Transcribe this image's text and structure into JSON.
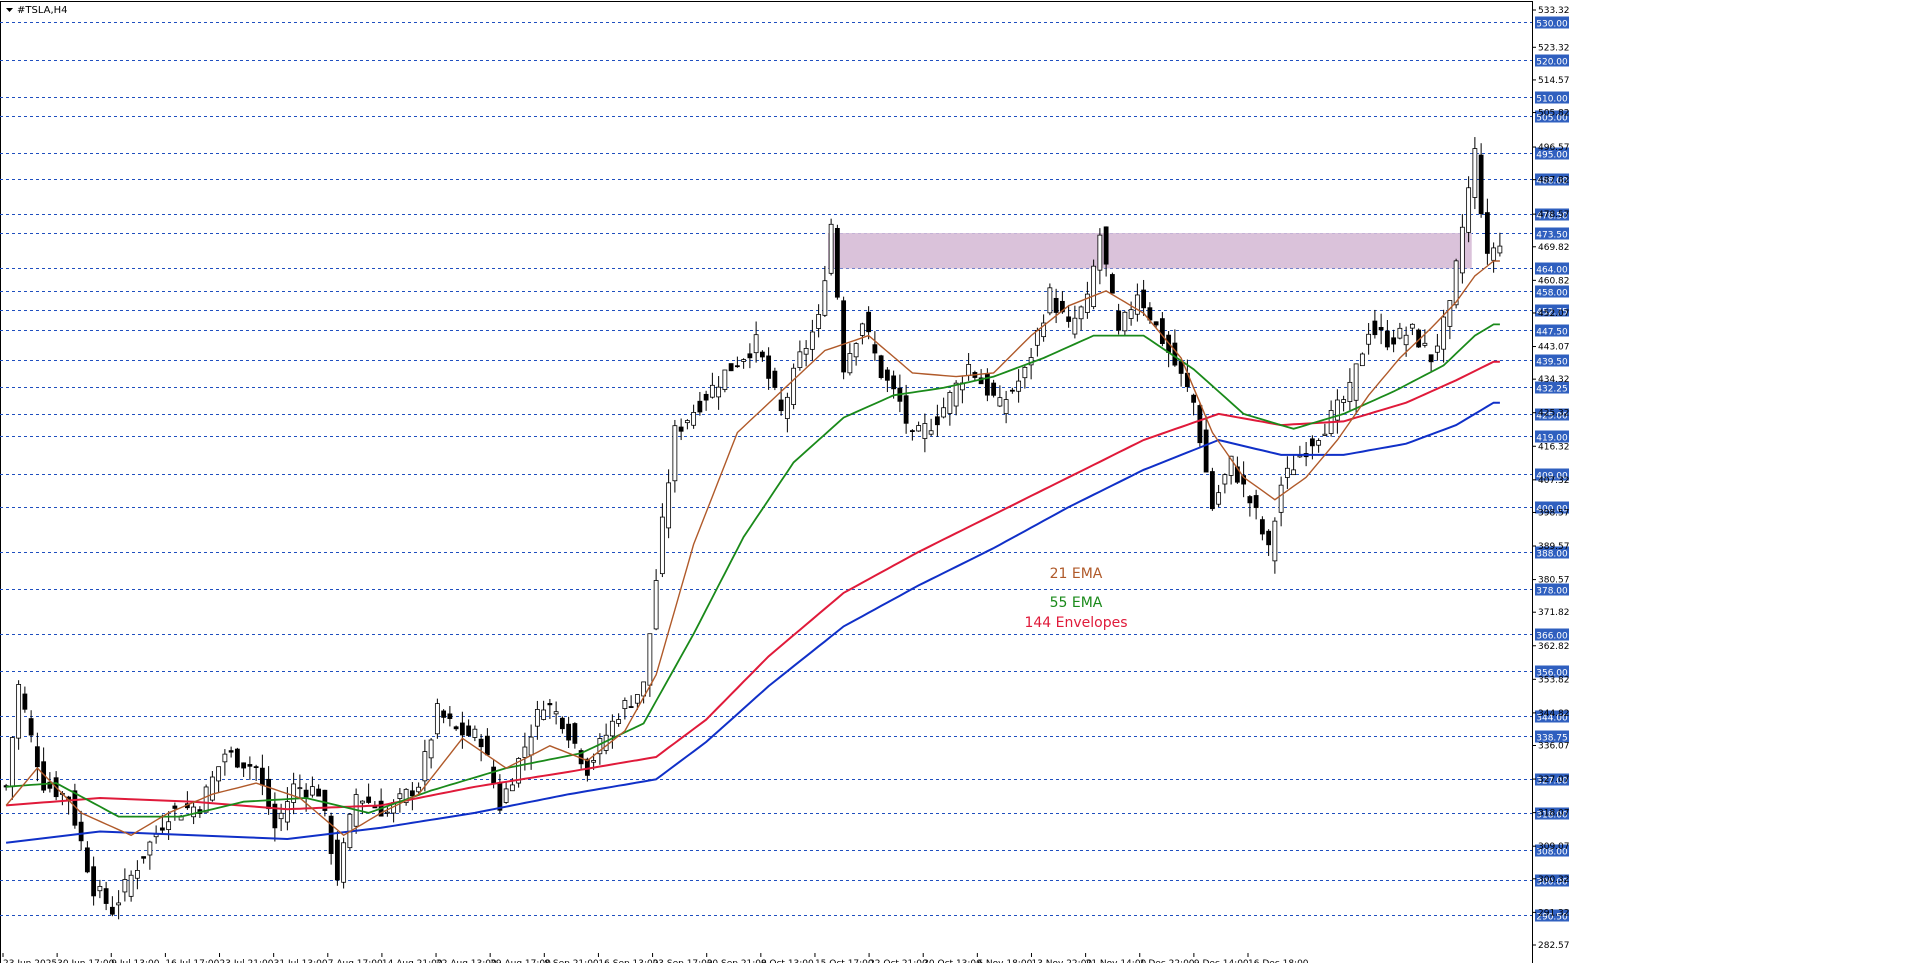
{
  "window": {
    "title": "#TSLA,H4",
    "menu_icon": "triangle-down-icon"
  },
  "colors": {
    "background": "#ffffff",
    "candle": "#000000",
    "grid": "#1f4fbf",
    "label_bg": "#2f5fbf",
    "label_text": "#ffffff",
    "axis_text": "#000000",
    "zone_fill": "#d8bfd8",
    "ema21": "#b05a2a",
    "ema55": "#1a8a1a",
    "env144": "#e01a3a",
    "env144_lower": "#1030c8"
  },
  "chart_data": {
    "type": "candlestick",
    "symbol": "#TSLA",
    "timeframe": "H4",
    "ylim": [
      282.57,
      533.32
    ],
    "price_axis_ticks": [
      533.32,
      523.32,
      514.57,
      505.82,
      496.57,
      487.82,
      478.57,
      469.82,
      460.82,
      452.07,
      443.07,
      434.32,
      425.32,
      416.32,
      407.32,
      398.57,
      389.57,
      380.57,
      371.82,
      362.82,
      353.82,
      344.82,
      336.07,
      327.07,
      318.07,
      309.07,
      300.32,
      291.32,
      282.57
    ],
    "level_lines": [
      530.0,
      520.0,
      510.0,
      505.0,
      495.0,
      488.0,
      478.5,
      473.5,
      464.0,
      458.0,
      452.75,
      447.5,
      439.5,
      432.25,
      425.0,
      419.0,
      409.0,
      400.0,
      388.0,
      378.0,
      366.0,
      356.0,
      344.0,
      338.75,
      327.0,
      318.0,
      308.0,
      300.0,
      290.5
    ],
    "level_labels": [
      "530.00",
      "520.00",
      "510.00",
      "505.00",
      "495.00",
      "488.00",
      "478.50",
      "473.50",
      "464.00",
      "458.00",
      "452.75",
      "447.50",
      "439.50",
      "432.25",
      "425.00",
      "419.00",
      "409.00",
      "400.00",
      "388.00",
      "378.00",
      "366.00",
      "356.00",
      "344.00",
      "338.75",
      "327.00",
      "318.00",
      "308.00",
      "300.00",
      "290.50"
    ],
    "time_labels": [
      "23 Jun 2025",
      "30 Jun 17:00",
      "9 Jul 13:00",
      "16 Jul 17:00",
      "23 Jul 21:00",
      "31 Jul 13:00",
      "7 Aug 17:00",
      "14 Aug 21:00",
      "22 Aug 13:00",
      "29 Aug 17:00",
      "8 Sep 21:00",
      "16 Sep 13:00",
      "23 Sep 17:00",
      "30 Sep 21:00",
      "8 Oct 13:00",
      "15 Oct 17:00",
      "22 Oct 21:00",
      "30 Oct 13:00",
      "6 Nov 18:00",
      "13 Nov 22:00",
      "21 Nov 14:00",
      "1 Dec 22:00",
      "9 Dec 14:00",
      "16 Dec 18:00"
    ],
    "zone": {
      "from_bar": 132,
      "to_bar": 235,
      "low": 464.0,
      "high": 473.5
    },
    "legend": [
      {
        "name": "21 EMA",
        "color": "#b05a2a"
      },
      {
        "name": "55 EMA",
        "color": "#1a8a1a"
      },
      {
        "name": "144 Envelopes",
        "color": "#e01a3a"
      }
    ],
    "price_path": [
      [
        0,
        325
      ],
      [
        2,
        352
      ],
      [
        4,
        338
      ],
      [
        6,
        326
      ],
      [
        10,
        322
      ],
      [
        14,
        298
      ],
      [
        17,
        292
      ],
      [
        22,
        307
      ],
      [
        26,
        318
      ],
      [
        31,
        320
      ],
      [
        35,
        334
      ],
      [
        40,
        330
      ],
      [
        43,
        314
      ],
      [
        46,
        325
      ],
      [
        50,
        324
      ],
      [
        53,
        301
      ],
      [
        56,
        323
      ],
      [
        61,
        318
      ],
      [
        66,
        326
      ],
      [
        69,
        345
      ],
      [
        72,
        340
      ],
      [
        76,
        338
      ],
      [
        79,
        320
      ],
      [
        82,
        332
      ],
      [
        86,
        348
      ],
      [
        89,
        343
      ],
      [
        93,
        330
      ],
      [
        98,
        345
      ],
      [
        102,
        352
      ],
      [
        105,
        395
      ],
      [
        107,
        420
      ],
      [
        110,
        426
      ],
      [
        115,
        436
      ],
      [
        120,
        444
      ],
      [
        124,
        425
      ],
      [
        127,
        440
      ],
      [
        130,
        450
      ],
      [
        132,
        476
      ],
      [
        134,
        438
      ],
      [
        137,
        450
      ],
      [
        140,
        436
      ],
      [
        143,
        428
      ],
      [
        145,
        418
      ],
      [
        149,
        424
      ],
      [
        154,
        438
      ],
      [
        159,
        427
      ],
      [
        163,
        436
      ],
      [
        167,
        457
      ],
      [
        170,
        448
      ],
      [
        173,
        455
      ],
      [
        175,
        473
      ],
      [
        178,
        446
      ],
      [
        181,
        458
      ],
      [
        185,
        445
      ],
      [
        190,
        428
      ],
      [
        193,
        400
      ],
      [
        196,
        412
      ],
      [
        200,
        398
      ],
      [
        202,
        388
      ],
      [
        204,
        406
      ],
      [
        207,
        414
      ],
      [
        212,
        424
      ],
      [
        215,
        431
      ],
      [
        218,
        448
      ],
      [
        221,
        445
      ],
      [
        225,
        447
      ],
      [
        228,
        440
      ],
      [
        231,
        453
      ],
      [
        233,
        475
      ],
      [
        235,
        495
      ],
      [
        237,
        466
      ],
      [
        238,
        470
      ]
    ],
    "ema21_path": [
      [
        0,
        320
      ],
      [
        5,
        330
      ],
      [
        12,
        318
      ],
      [
        20,
        312
      ],
      [
        26,
        318
      ],
      [
        33,
        323
      ],
      [
        40,
        326
      ],
      [
        47,
        322
      ],
      [
        54,
        312
      ],
      [
        60,
        318
      ],
      [
        66,
        323
      ],
      [
        73,
        338
      ],
      [
        80,
        330
      ],
      [
        87,
        336
      ],
      [
        93,
        332
      ],
      [
        99,
        340
      ],
      [
        104,
        355
      ],
      [
        110,
        390
      ],
      [
        117,
        420
      ],
      [
        124,
        431
      ],
      [
        131,
        442
      ],
      [
        138,
        446
      ],
      [
        145,
        436
      ],
      [
        152,
        435
      ],
      [
        158,
        436
      ],
      [
        164,
        446
      ],
      [
        170,
        454
      ],
      [
        176,
        458
      ],
      [
        182,
        452
      ],
      [
        188,
        440
      ],
      [
        193,
        420
      ],
      [
        198,
        408
      ],
      [
        203,
        402
      ],
      [
        208,
        408
      ],
      [
        213,
        418
      ],
      [
        218,
        430
      ],
      [
        223,
        440
      ],
      [
        228,
        448
      ],
      [
        232,
        455
      ],
      [
        235,
        462
      ],
      [
        238,
        466
      ]
    ],
    "ema55_path": [
      [
        0,
        325
      ],
      [
        8,
        326
      ],
      [
        18,
        317
      ],
      [
        28,
        317
      ],
      [
        38,
        321
      ],
      [
        48,
        322
      ],
      [
        58,
        318
      ],
      [
        68,
        324
      ],
      [
        80,
        330
      ],
      [
        92,
        334
      ],
      [
        102,
        342
      ],
      [
        110,
        366
      ],
      [
        118,
        392
      ],
      [
        126,
        412
      ],
      [
        134,
        424
      ],
      [
        142,
        430
      ],
      [
        150,
        432
      ],
      [
        158,
        435
      ],
      [
        166,
        440
      ],
      [
        174,
        446
      ],
      [
        182,
        446
      ],
      [
        190,
        437
      ],
      [
        198,
        425
      ],
      [
        206,
        421
      ],
      [
        214,
        425
      ],
      [
        222,
        431
      ],
      [
        230,
        438
      ],
      [
        235,
        446
      ],
      [
        238,
        449
      ]
    ],
    "env144_path": [
      [
        0,
        320
      ],
      [
        15,
        322
      ],
      [
        30,
        321
      ],
      [
        45,
        319
      ],
      [
        60,
        320
      ],
      [
        75,
        325
      ],
      [
        90,
        329
      ],
      [
        104,
        333
      ],
      [
        112,
        343
      ],
      [
        122,
        360
      ],
      [
        134,
        377
      ],
      [
        146,
        388
      ],
      [
        158,
        398
      ],
      [
        170,
        408
      ],
      [
        182,
        418
      ],
      [
        194,
        425
      ],
      [
        204,
        422
      ],
      [
        214,
        423
      ],
      [
        224,
        428
      ],
      [
        232,
        434
      ],
      [
        238,
        439
      ]
    ],
    "env144_lower_path": [
      [
        0,
        310
      ],
      [
        15,
        313
      ],
      [
        30,
        312
      ],
      [
        45,
        311
      ],
      [
        60,
        314
      ],
      [
        75,
        318
      ],
      [
        90,
        323
      ],
      [
        104,
        327
      ],
      [
        112,
        337
      ],
      [
        122,
        352
      ],
      [
        134,
        368
      ],
      [
        146,
        379
      ],
      [
        158,
        389
      ],
      [
        170,
        400
      ],
      [
        182,
        410
      ],
      [
        194,
        418
      ],
      [
        204,
        414
      ],
      [
        214,
        414
      ],
      [
        224,
        417
      ],
      [
        232,
        422
      ],
      [
        238,
        428
      ]
    ]
  }
}
